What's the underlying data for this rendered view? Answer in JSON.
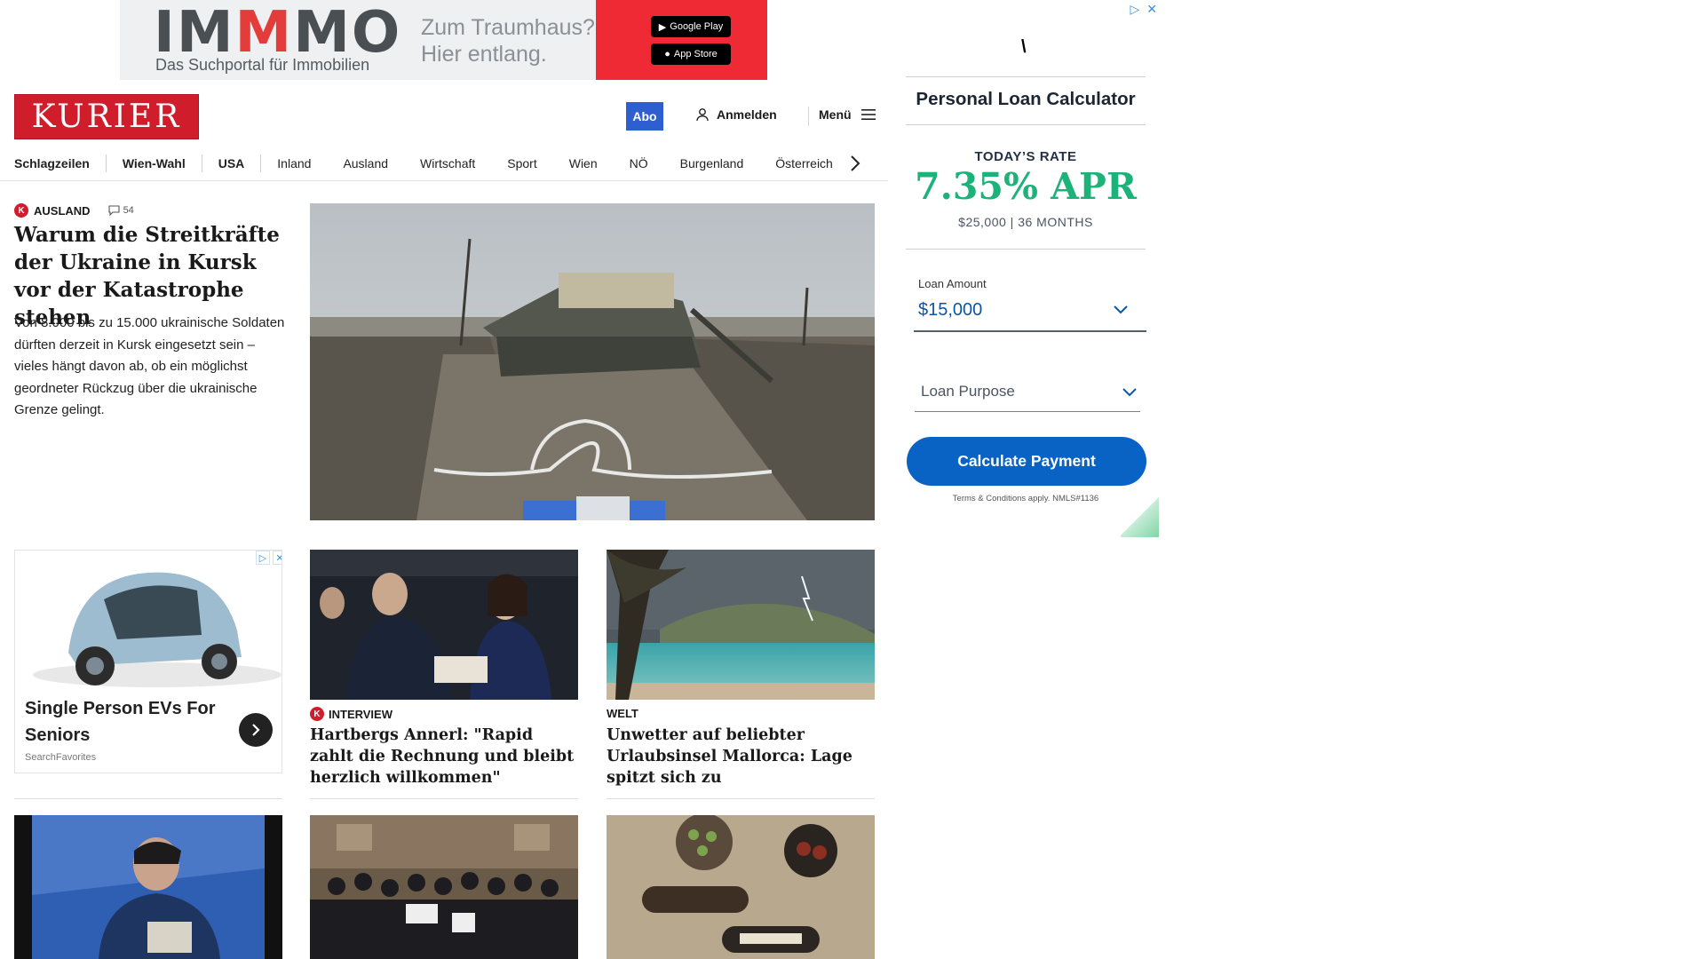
{
  "banner_ad": {
    "logo_part1": "IM",
    "logo_part2": "M",
    "logo_part3": "MO",
    "tagline": "Das Suchportal für Immobilien",
    "slogan": "Zum Traumhaus? Hier entlang.",
    "google_play": "Google Play",
    "app_store": "App Store"
  },
  "header": {
    "logo": "KURIER",
    "abo": "Abo",
    "login": "Anmelden",
    "menu": "Menü"
  },
  "nav": {
    "items": [
      "Schlagzeilen",
      "Wien-Wahl",
      "USA",
      "Inland",
      "Ausland",
      "Wirtschaft",
      "Sport",
      "Wien",
      "NÖ",
      "Burgenland",
      "Österreich"
    ]
  },
  "hero": {
    "category": "AUSLAND",
    "comments": "54",
    "title": "Warum die Streitkräfte der Ukraine in Kursk vor der Katastrophe stehen",
    "lead": "Von 8.000 bis zu 15.000 ukrainische Soldaten dürften derzeit in Kursk eingesetzt sein – vieles hängt davon ab, ob ein möglichst geordneter Rückzug über die ukrainische Grenze gelingt."
  },
  "ad_card": {
    "title": "Single Person EVs For Seniors",
    "source": "SearchFavorites"
  },
  "articles": [
    {
      "category": "INTERVIEW",
      "title": "Hartbergs Annerl: \"Rapid zahlt die Rechnung und bleibt herzlich willkommen\""
    },
    {
      "category": "WELT",
      "title": "Unwetter auf beliebter Urlaubsinsel Mallorca: Lage spitzt sich zu"
    }
  ],
  "calculator": {
    "heading": "Personal Loan Calculator",
    "rate_label": "TODAY’S RATE",
    "rate": "7.35% APR",
    "rate_sub": "$25,000 | 36 MONTHS",
    "amount_label": "Loan Amount",
    "amount_value": "$15,000",
    "purpose_placeholder": "Loan Purpose",
    "cta": "Calculate Payment",
    "terms": "Terms & Conditions apply. NMLS#1136"
  },
  "colors": {
    "brand_red": "#cf1d2c",
    "abo_blue": "#2d5fd1",
    "rate_green": "#1db27a",
    "cta_blue": "#0963c4"
  }
}
